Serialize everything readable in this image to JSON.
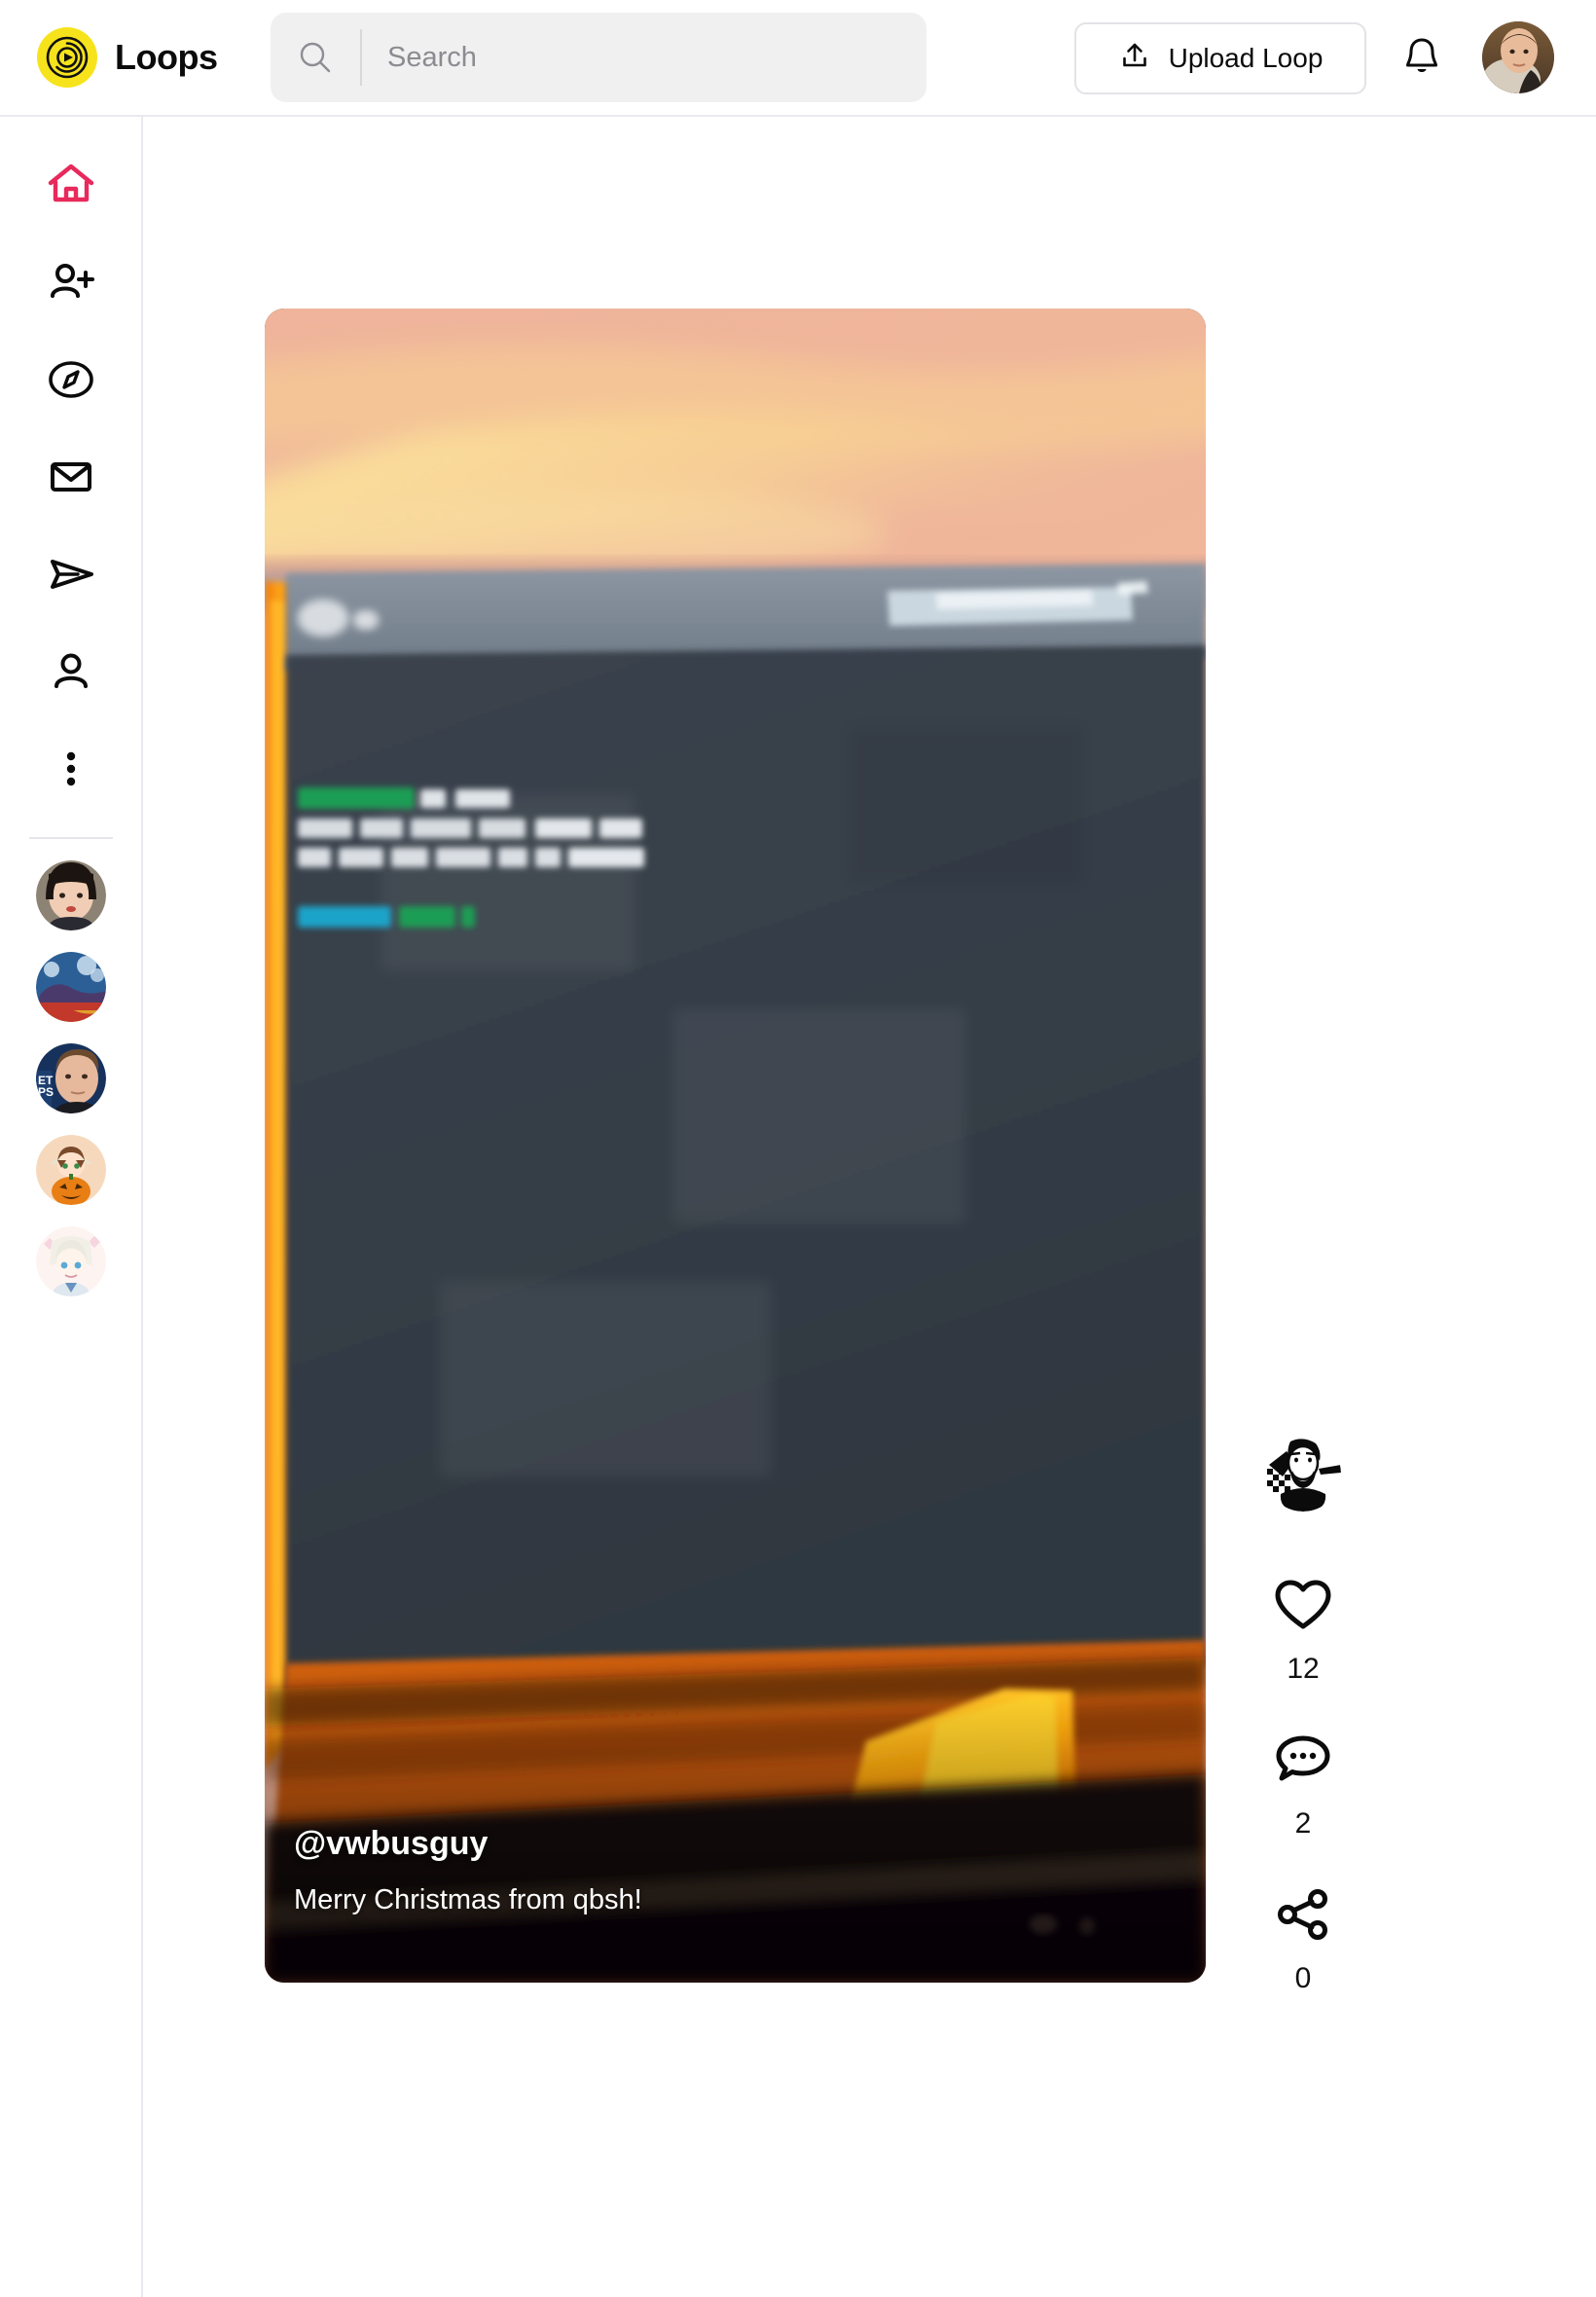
{
  "app": {
    "brand_name": "Loops",
    "logo_color": "#F7E31C",
    "accent_color": "#E8295B",
    "logo_icon": "loops-play-ring-icon"
  },
  "header": {
    "search": {
      "placeholder": "Search",
      "value": "",
      "icon": "search-icon",
      "input_name": "search-input"
    },
    "upload": {
      "label": "Upload Loop",
      "icon": "upload-arrow-icon"
    },
    "notifications": {
      "icon": "bell-icon",
      "label": "Notifications"
    },
    "account_avatar": {
      "icon": "user-avatar",
      "label": "Account"
    }
  },
  "sidebar": {
    "items": [
      {
        "name": "home",
        "icon": "home-icon",
        "active": true
      },
      {
        "name": "following",
        "icon": "user-plus-icon",
        "active": false
      },
      {
        "name": "explore",
        "icon": "compass-icon",
        "active": false
      },
      {
        "name": "inbox",
        "icon": "envelope-icon",
        "active": false
      },
      {
        "name": "messages",
        "icon": "paper-plane-icon",
        "active": false
      },
      {
        "name": "profile",
        "icon": "person-icon",
        "active": false
      },
      {
        "name": "more",
        "icon": "more-vertical-icon",
        "active": false
      }
    ],
    "suggested_accounts": [
      {
        "name": "account-1",
        "avatar": "photo-portrait-dark-hair"
      },
      {
        "name": "account-2",
        "avatar": "illustration-blue-landscape"
      },
      {
        "name": "account-3",
        "avatar": "photo-portrait-man"
      },
      {
        "name": "account-4",
        "avatar": "anime-pumpkin-character"
      },
      {
        "name": "account-5",
        "avatar": "anime-white-hair-character"
      }
    ]
  },
  "feed": {
    "post": {
      "username": "@vwbusguy",
      "caption": "Merry Christmas from qbsh!",
      "author_avatar": "monochrome-bearded-man",
      "media_description": "blurry photo of a computer monitor showing a dark terminal, with an orange sunset sky visible behind",
      "actions": [
        {
          "name": "like",
          "icon": "heart-icon",
          "count": "12"
        },
        {
          "name": "comment",
          "icon": "comment-bubble-icon",
          "count": "2"
        },
        {
          "name": "share",
          "icon": "share-nodes-icon",
          "count": "0"
        }
      ]
    }
  }
}
